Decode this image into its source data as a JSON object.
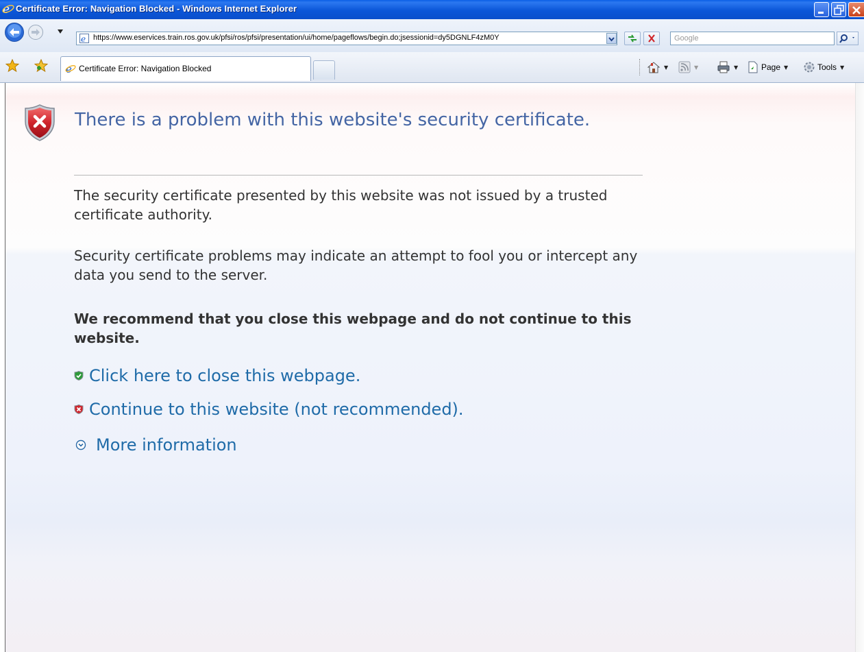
{
  "window": {
    "title": "Certificate Error: Navigation Blocked - Windows Internet Explorer"
  },
  "address_bar": {
    "url": "https://www.eservices.train.ros.gov.uk/pfsi/ros/pfsi/presentation/ui/home/pageflows/begin.do;jsessionid=dy5DGNLF4zM0Y"
  },
  "search": {
    "placeholder": "Google"
  },
  "tabs": [
    {
      "label": "Certificate Error: Navigation Blocked"
    }
  ],
  "command_bar": {
    "page_label": "Page",
    "tools_label": "Tools"
  },
  "content": {
    "title": "There is a problem with this website's security certificate.",
    "paragraph_1": "The security certificate presented by this website was not issued by a trusted certificate authority.",
    "paragraph_2": "Security certificate problems may indicate an attempt to fool you or intercept any data you send to the server.",
    "recommendation": "We recommend that you close this webpage and do not continue to this website.",
    "close_link": "Click here to close this webpage.",
    "continue_link": "Continue to this website (not recommended).",
    "more_info": "More information"
  },
  "colors": {
    "title_bar": "#0b56d8",
    "heading_text": "#4465a4",
    "link_text": "#1f6ba8",
    "shield_red": "#c8202a"
  }
}
